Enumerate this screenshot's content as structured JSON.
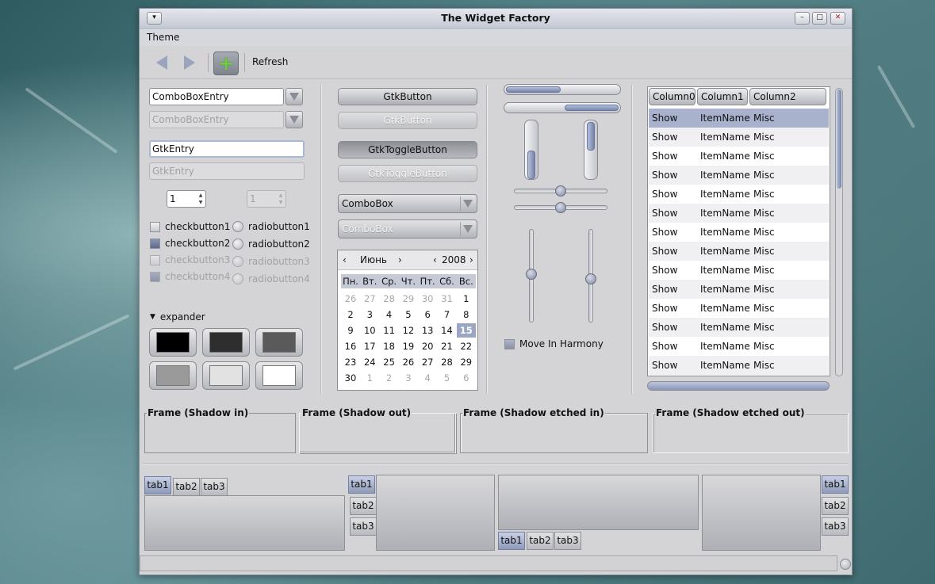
{
  "window": {
    "title": "The Widget Factory"
  },
  "menubar": {
    "items": [
      "Theme"
    ]
  },
  "toolbar": {
    "refresh_label": "Refresh"
  },
  "entries": {
    "combo_entry_1": "ComboBoxEntry",
    "combo_entry_2": "ComboBoxEntry",
    "gtk_entry_1": "GtkEntry",
    "gtk_entry_2": "GtkEntry"
  },
  "spin": {
    "value_1": "1",
    "value_2": "1"
  },
  "checks": [
    "checkbutton1",
    "checkbutton2",
    "checkbutton3",
    "checkbutton4"
  ],
  "radios": [
    "radiobutton1",
    "radiobutton2",
    "radiobutton3",
    "radiobutton4"
  ],
  "expander": {
    "label": "expander"
  },
  "swatches": [
    "#000000",
    "#2e2e2e",
    "#5a5a5a",
    "#9a9a9a",
    "#e2e2e2",
    "#ffffff"
  ],
  "buttons": {
    "gtk_button": "GtkButton",
    "gtk_button_disabled": "GtkButton",
    "toggle": "GtkToggleButton",
    "toggle_disabled": "GtkToggleButton",
    "combo_1": "ComboBox",
    "combo_2": "ComboBox"
  },
  "calendar": {
    "month": "Июнь",
    "year": "2008",
    "weekdays": [
      "Пн.",
      "Вт.",
      "Ср.",
      "Чт.",
      "Пт.",
      "Сб.",
      "Вс."
    ],
    "days": [
      [
        "26",
        "27",
        "28",
        "29",
        "30",
        "31",
        "1"
      ],
      [
        "2",
        "3",
        "4",
        "5",
        "6",
        "7",
        "8"
      ],
      [
        "9",
        "10",
        "11",
        "12",
        "13",
        "14",
        "15"
      ],
      [
        "16",
        "17",
        "18",
        "19",
        "20",
        "21",
        "22"
      ],
      [
        "23",
        "24",
        "25",
        "26",
        "27",
        "28",
        "29"
      ],
      [
        "30",
        "1",
        "2",
        "3",
        "4",
        "5",
        "6"
      ]
    ],
    "selected": "15"
  },
  "progress": {
    "h1": 0.48,
    "h2": 0.47,
    "v1": 0.5,
    "v2": 0.5
  },
  "scales": {
    "h1": 0.5,
    "h2": 0.5,
    "v1": 0.48,
    "v2": 0.53
  },
  "harmony": {
    "label": "Move In Harmony"
  },
  "tree": {
    "columns": [
      "Column0",
      "Column1",
      "Column2"
    ],
    "row": {
      "c0": "Show",
      "c1": "ItemName",
      "c2": "Misc"
    },
    "row_count": 14
  },
  "frames": [
    "Frame (Shadow in)",
    "Frame (Shadow out)",
    "Frame (Shadow etched in)",
    "Frame (Shadow etched out)"
  ],
  "tabs": [
    "tab1",
    "tab2",
    "tab3"
  ]
}
